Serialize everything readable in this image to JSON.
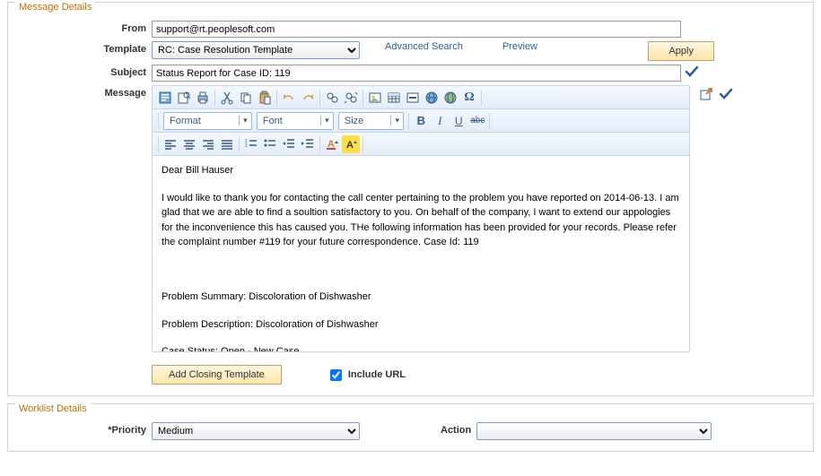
{
  "panels": {
    "message": {
      "title": "Message Details"
    },
    "worklist": {
      "title": "Worklist Details"
    }
  },
  "labels": {
    "from": "From",
    "template": "Template",
    "subject": "Subject",
    "message": "Message",
    "priority": "*Priority",
    "action": "Action"
  },
  "fields": {
    "from_value": "support@rt.peoplesoft.com",
    "template_value": "RC: Case Resolution Template",
    "subject_value": "Status Report for Case ID: 119",
    "priority_value": "Medium",
    "action_value": ""
  },
  "links": {
    "advanced_search": "Advanced Search",
    "preview": "Preview"
  },
  "buttons": {
    "apply": "Apply",
    "add_closing": "Add Closing Template"
  },
  "checkboxes": {
    "include_url_label": "Include URL",
    "include_url_checked": true
  },
  "editor": {
    "toolbar2": {
      "format_label": "Format",
      "format_value": "",
      "font_label": "Font",
      "font_value": "",
      "size_label": "Size",
      "size_value": "",
      "bold_glyph": "B",
      "italic_glyph": "I",
      "underline_glyph": "U",
      "strike_glyph": "abc"
    },
    "body": {
      "greeting": "Dear Bill Hauser",
      "para1": "I would like to thank you for contacting the call center pertaining to the problem you have reported on 2014-06-13. I am glad that we are able to find a soultion satisfactory to you. On behalf of the company, I want to extend our appologies for the inconvenience this has caused you. THe following information has been provided for your records. Please refer the complaint number #119 for your future correspondence. Case Id: 119",
      "problem_summary": "Problem Summary: Discoloration of Dishwasher",
      "problem_description": "Problem Description: Discoloration of Dishwasher",
      "case_status": "Case Status: Open - New Case"
    }
  }
}
